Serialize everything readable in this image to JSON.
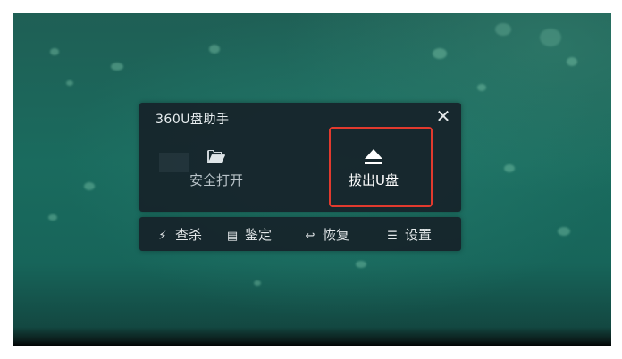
{
  "widget": {
    "title": "360U盘助手",
    "close_symbol": "✕",
    "actions": {
      "open": {
        "label": "安全打开",
        "icon": "folder-open-icon"
      },
      "eject": {
        "label": "拔出U盘",
        "icon": "eject-icon"
      }
    }
  },
  "toolbar": {
    "items": [
      {
        "label": "查杀",
        "icon": "lightning-icon",
        "glyph": "⚡"
      },
      {
        "label": "鉴定",
        "icon": "chip-icon",
        "glyph": "▤"
      },
      {
        "label": "恢复",
        "icon": "restore-icon",
        "glyph": "↩"
      },
      {
        "label": "设置",
        "icon": "menu-icon",
        "glyph": "☰"
      }
    ]
  },
  "colors": {
    "highlight": "#e23a2e",
    "panel_bg": "#162028",
    "wallpaper": "#1a6b5e"
  }
}
